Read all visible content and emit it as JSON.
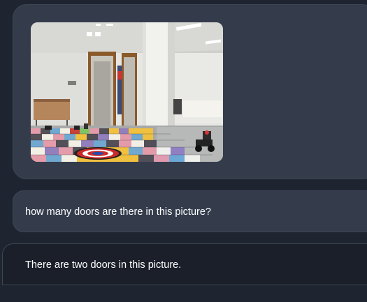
{
  "messages": [
    {
      "role": "user",
      "type": "image",
      "image_alt": ""
    },
    {
      "role": "user",
      "type": "text",
      "text": "how many doors are there in this picture?"
    },
    {
      "role": "assistant",
      "type": "text",
      "text": "There are two doors in this picture."
    }
  ],
  "colors": {
    "page_bg": "#1f2530",
    "user_bubble": "#343c4c",
    "assistant_bubble": "#1a1f29",
    "bubble_border": "#3e4654",
    "text": "#ffffff"
  }
}
